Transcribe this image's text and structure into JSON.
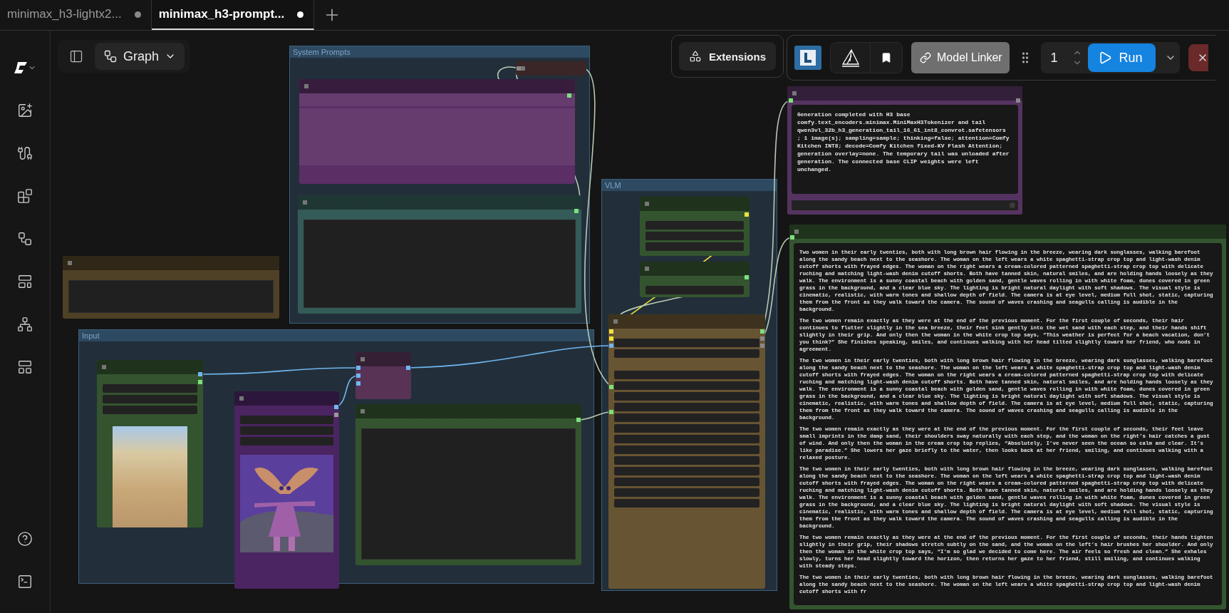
{
  "tabs": [
    {
      "label": "minimax_h3-lightx2...",
      "selected": false,
      "unsaved": true
    },
    {
      "label": "minimax_h3-prompt...",
      "selected": true,
      "unsaved": true
    }
  ],
  "graph_toolbar": {
    "mode": "Graph"
  },
  "extensions": {
    "label": "Extensions"
  },
  "run_toolbar": {
    "model_linker": "Model Linker",
    "batch_count": "1",
    "run": "Run"
  },
  "groups": [
    {
      "title": "System Prompts"
    },
    {
      "title": "VLM"
    },
    {
      "title": "Input"
    }
  ],
  "nodes": [
    {
      "kind": "collapsed",
      "color": "#3a2626"
    },
    {
      "kind": "bands",
      "color": "#5b2e65"
    },
    {
      "kind": "textarea",
      "color": "#345b57"
    },
    {
      "kind": "textarea",
      "color": "#4f4126"
    },
    {
      "kind": "widgets",
      "color": "#34542f"
    },
    {
      "kind": "widgets",
      "color": "#34542f"
    },
    {
      "kind": "widgets",
      "color": "#675432"
    },
    {
      "kind": "text",
      "color": "#553360",
      "paragraphs": [
        "Generation completed with H3 base comfy.text_encoders.minimax.MiniMaxH3Tokenizer and tail qwen3vl_32b_h3_generation_tail_16_61_int8_convrot.safetensors ; 1 image(s); sampling=sample; thinking=false; attention=Comfy Kitchen INT8; decode=Comfy Kitchen fixed-KV Flash Attention; generation overlay=none. The temporary tail was unloaded after generation. The connected base CLIP weights were left unchanged."
      ]
    },
    {
      "kind": "text",
      "color": "#33552f",
      "paragraphs": [
        "Two women in their early twenties, both with long brown hair flowing in the breeze, wearing dark sunglasses, walking barefoot along the sandy beach next to the seashore. The woman on the left wears a white spaghetti-strap crop top and light-wash denim cutoff shorts with frayed edges. The woman on the right wears a cream-colored patterned spaghetti-strap crop top with delicate ruching and matching light-wash denim cutoff shorts. Both have tanned skin, natural smiles, and are holding hands loosely as they walk. The environment is a sunny coastal beach with golden sand, gentle waves rolling in with white foam, dunes covered in green grass in the background, and a clear blue sky. The lighting is bright natural daylight with soft shadows. The visual style is cinematic, realistic, with warm tones and shallow depth of field. The camera is at eye level, medium full shot, static, capturing them from the front as they walk toward the camera. The sound of waves crashing and seagulls calling is audible in the background.",
        "The two women remain exactly as they were at the end of the previous moment. For the first couple of seconds, their hair continues to flutter slightly in the sea breeze, their feet sink gently into the wet sand with each step, and their hands shift slightly in their grip. And only then the woman in the white crop top says, “This weather is perfect for a beach vacation, don’t you think?” She finishes speaking, smiles, and continues walking with her head tilted slightly toward her friend, who nods in agreement.",
        "The two women in their early twenties, both with long brown hair flowing in the breeze, wearing dark sunglasses, walking barefoot along the sandy beach next to the seashore. The woman on the left wears a white spaghetti-strap crop top and light-wash denim cutoff shorts with frayed edges. The woman on the right wears a cream-colored patterned spaghetti-strap crop top with delicate ruching and matching light-wash denim cutoff shorts. Both have tanned skin, natural smiles, and are holding hands loosely as they walk. The environment is a sunny coastal beach with golden sand, gentle waves rolling in with white foam, dunes covered in green grass in the background, and a clear blue sky. The lighting is bright natural daylight with soft shadows. The visual style is cinematic, realistic, with warm tones and shallow depth of field. The camera is at eye level, medium full shot, static, capturing them from the front as they walk toward the camera. The sound of waves crashing and seagulls calling is audible in the background.",
        "The two women remain exactly as they were at the end of the previous moment. For the first couple of seconds, their feet leave small imprints in the damp sand, their shoulders sway naturally with each step, and the woman on the right’s hair catches a gust of wind. And only then the woman in the cream crop top replies, “Absolutely, I’ve never seen the ocean so calm and clear. It’s like paradise.” She lowers her gaze briefly to the water, then looks back at her friend, smiling, and continues walking with a relaxed posture.",
        "The two women in their early twenties, both with long brown hair flowing in the breeze, wearing dark sunglasses, walking barefoot along the sandy beach next to the seashore. The woman on the left wears a white spaghetti-strap crop top and light-wash denim cutoff shorts with frayed edges. The woman on the right wears a cream-colored patterned spaghetti-strap crop top with delicate ruching and matching light-wash denim cutoff shorts. Both have tanned skin, natural smiles, and are holding hands loosely as they walk. The environment is a sunny coastal beach with golden sand, gentle waves rolling in with white foam, dunes covered in green grass in the background, and a clear blue sky. The lighting is bright natural daylight with soft shadows. The visual style is cinematic, realistic, with warm tones and shallow depth of field. The camera is at eye level, medium full shot, static, capturing them from the front as they walk toward the camera. The sound of waves crashing and seagulls calling is audible in the background.",
        "The two women remain exactly as they were at the end of the previous moment. For the first couple of seconds, their hands tighten slightly in their grip, their shadows stretch subtly on the sand, and the woman on the left’s hair brushes her shoulder. And only then the woman in the white crop top says, “I’m so glad we decided to come here. The air feels so fresh and clean.” She exhales slowly, turns her head slightly toward the horizon, then returns her gaze to her friend, still smiling, and continues walking with steady steps.",
        "The two women in their early twenties, both with long brown hair flowing in the breeze, wearing dark sunglasses, walking barefoot along the sandy beach next to the seashore. The woman on the left wears a white spaghetti-strap crop top and light-wash denim cutoff shorts with fr"
      ]
    },
    {
      "kind": "image",
      "color": "#34542f"
    },
    {
      "kind": "drawing",
      "color": "#4b2462"
    },
    {
      "kind": "widgets",
      "color": "#583356"
    },
    {
      "kind": "textarea",
      "color": "#34542f"
    }
  ]
}
